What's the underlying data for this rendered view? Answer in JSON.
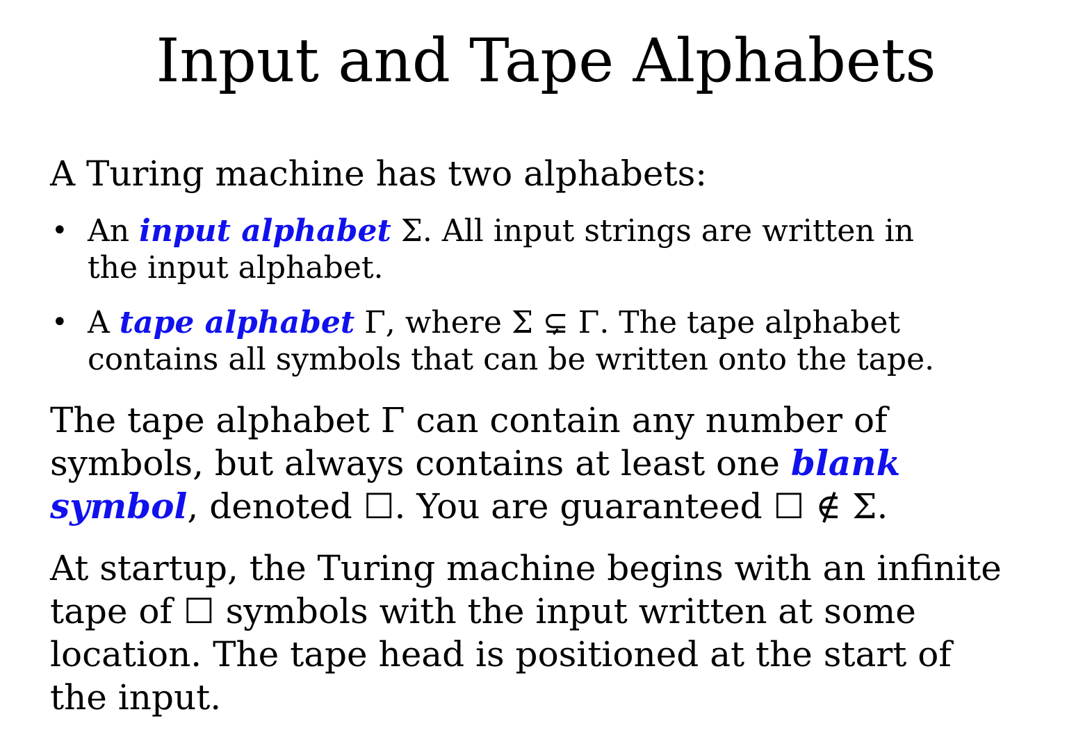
{
  "title": "Input and Tape Alphabets",
  "intro": "A Turing machine has two alphabets:",
  "bullets": [
    {
      "line1_pre": "An ",
      "term": "input alphabet",
      "line1_post": " Σ. All input strings are written in",
      "line2": "the input alphabet."
    },
    {
      "line1_pre": "A ",
      "term": "tape alphabet",
      "line1_post": " Γ, where Σ ⊊ Γ. The tape alphabet",
      "line2": "contains all symbols that can be written onto the tape."
    }
  ],
  "blank_paragraph": {
    "line1": "The tape alphabet Γ can contain any number of",
    "line2_pre": "symbols, but always contains at least one ",
    "term_part1": "blank",
    "term_part2": "symbol",
    "line3_post": ", denoted ☐. You are guaranteed ☐ ∉ Σ."
  },
  "startup_paragraph": {
    "line1": "At startup, the Turing machine begins with an infinite",
    "line2": "tape of ☐ symbols with the input written at some",
    "line3": "location. The tape head is positioned at the start of",
    "line4": "the input."
  },
  "colors": {
    "term": "#1111ee",
    "text": "#000000",
    "background": "#ffffff"
  }
}
